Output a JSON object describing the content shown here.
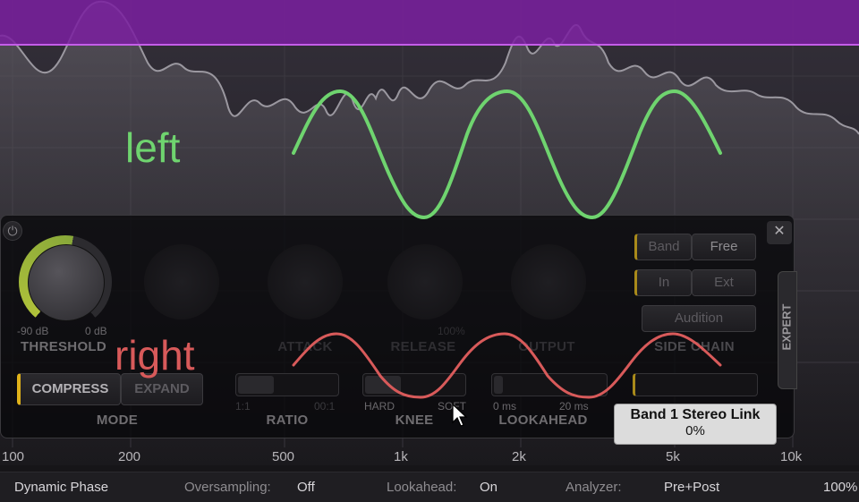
{
  "colors": {
    "band_region": "#7a1fa0",
    "spectrum": "#8f8c93",
    "left_wave": "#6fd46f",
    "right_wave": "#d85a5a",
    "accent_knob": "#b0c23a"
  },
  "wave_labels": {
    "left": "left",
    "right": "right"
  },
  "panel": {
    "threshold": {
      "label": "THRESHOLD",
      "min": "-90 dB",
      "max": "0 dB"
    },
    "attack": {
      "label": "ATTACK"
    },
    "release": {
      "label": "RELEASE",
      "max": "100%"
    },
    "output": {
      "label": "OUTPUT"
    },
    "mode": {
      "label": "MODE",
      "compress": "COMPRESS",
      "expand": "EXPAND"
    },
    "ratio": {
      "label": "RATIO",
      "min": "1:1",
      "max": "00:1"
    },
    "knee": {
      "label": "KNEE",
      "min": "HARD",
      "max": "SOFT"
    },
    "lookahead": {
      "label": "LOOKAHEAD",
      "min": "0 ms",
      "max": "20 ms"
    },
    "side_chain": {
      "label": "SIDE CHAIN",
      "band": "Band",
      "free": "Free",
      "in": "In",
      "ext": "Ext",
      "audition": "Audition"
    },
    "expert": "EXPERT",
    "close": "✕",
    "power": "⏻"
  },
  "tooltip": {
    "title": "Band 1 Stereo Link",
    "value": "0%"
  },
  "freq_scale": [
    "100",
    "200",
    "500",
    "1k",
    "2k",
    "5k",
    "10k"
  ],
  "statusbar": {
    "dynamic_phase": "Dynamic Phase",
    "oversampling_label": "Oversampling:",
    "oversampling_value": "Off",
    "lookahead_label": "Lookahead:",
    "lookahead_value": "On",
    "analyzer_label": "Analyzer:",
    "analyzer_value": "Pre+Post",
    "zoom": "100%"
  }
}
